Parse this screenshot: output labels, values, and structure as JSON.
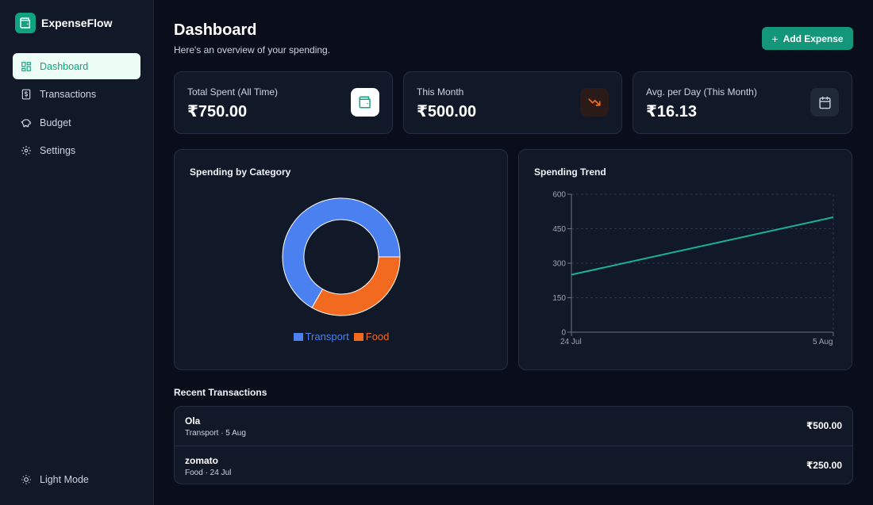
{
  "app": {
    "name": "ExpenseFlow"
  },
  "sidebar": {
    "items": [
      {
        "label": "Dashboard",
        "icon": "dashboard-icon",
        "active": true
      },
      {
        "label": "Transactions",
        "icon": "receipt-icon",
        "active": false
      },
      {
        "label": "Budget",
        "icon": "piggy-bank-icon",
        "active": false
      },
      {
        "label": "Settings",
        "icon": "gear-icon",
        "active": false
      }
    ],
    "theme_toggle": {
      "label": "Light Mode",
      "icon": "sun-icon"
    }
  },
  "header": {
    "title": "Dashboard",
    "subtitle": "Here's an overview of your spending.",
    "add_button": "Add Expense"
  },
  "stats": [
    {
      "label": "Total Spent (All Time)",
      "value": "₹750.00",
      "icon": "wallet-icon"
    },
    {
      "label": "This Month",
      "value": "₹500.00",
      "icon": "trending-down-icon"
    },
    {
      "label": "Avg. per Day (This Month)",
      "value": "₹16.13",
      "icon": "calendar-icon"
    }
  ],
  "category_chart": {
    "title": "Spending by Category"
  },
  "trend_chart": {
    "title": "Spending Trend"
  },
  "chart_data": [
    {
      "type": "pie",
      "title": "Spending by Category",
      "categories": [
        "Transport",
        "Food"
      ],
      "values": [
        500,
        250
      ],
      "colors": [
        "#4a80f0",
        "#f26a1f"
      ],
      "legend": "bottom"
    },
    {
      "type": "line",
      "title": "Spending Trend",
      "x": [
        "24 Jul",
        "5 Aug"
      ],
      "y": [
        250,
        500
      ],
      "yticks": [
        0,
        150,
        300,
        450,
        600
      ],
      "ylim": [
        0,
        600
      ],
      "color": "#19b39a",
      "grid": true
    }
  ],
  "transactions_section": {
    "title": "Recent Transactions"
  },
  "transactions": [
    {
      "name": "Ola",
      "meta": "Transport · 5 Aug",
      "amount": "₹500.00"
    },
    {
      "name": "zomato",
      "meta": "Food · 24 Jul",
      "amount": "₹250.00"
    }
  ],
  "colors": {
    "accent": "#10a37f",
    "background": "#0a0e1a",
    "card": "#111827",
    "transport": "#4a80f0",
    "food": "#f26a1f"
  }
}
